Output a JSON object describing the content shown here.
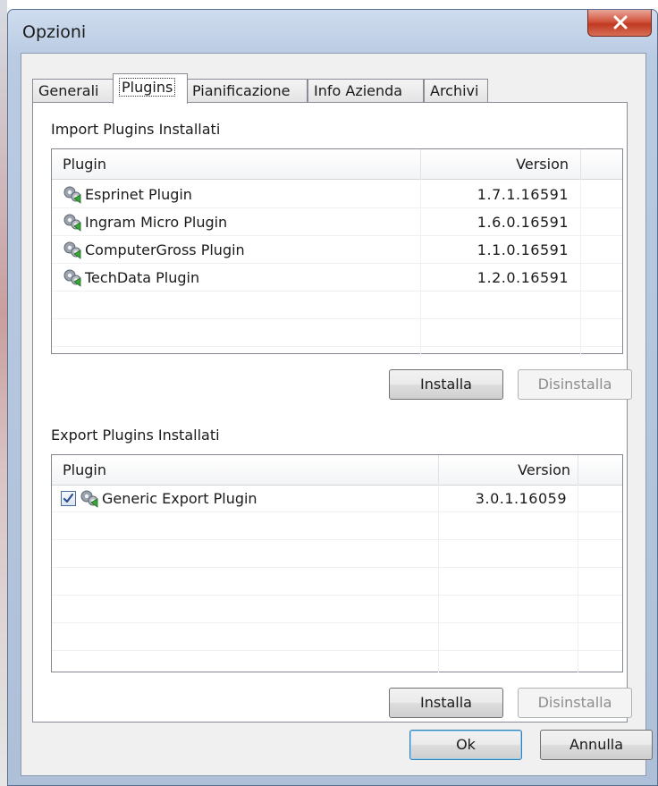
{
  "window": {
    "title": "Opzioni"
  },
  "tabs": [
    {
      "label": "Generali"
    },
    {
      "label": "Plugins"
    },
    {
      "label": "Pianificazione"
    },
    {
      "label": "Info Azienda"
    },
    {
      "label": "Archivi"
    }
  ],
  "active_tab": "Plugins",
  "import_section": {
    "label": "Import Plugins Installati",
    "columns": {
      "plugin": "Plugin",
      "version": "Version"
    },
    "rows": [
      {
        "name": "Esprinet Plugin",
        "version": "1.7.1.16591",
        "icon": "gears-icon"
      },
      {
        "name": "Ingram Micro Plugin",
        "version": "1.6.0.16591",
        "icon": "gears-icon"
      },
      {
        "name": "ComputerGross Plugin",
        "version": "1.1.0.16591",
        "icon": "gears-icon"
      },
      {
        "name": "TechData Plugin",
        "version": "1.2.0.16591",
        "icon": "gears-icon"
      }
    ],
    "install_label": "Installa",
    "uninstall_label": "Disinstalla"
  },
  "export_section": {
    "label": "Export Plugins Installati",
    "columns": {
      "plugin": "Plugin",
      "version": "Version"
    },
    "rows": [
      {
        "name": "Generic Export Plugin",
        "version": "3.0.1.16059",
        "checked": true,
        "icon": "gears-icon"
      }
    ],
    "install_label": "Installa",
    "uninstall_label": "Disinstalla"
  },
  "footer": {
    "ok_label": "Ok",
    "cancel_label": "Annulla"
  },
  "colors": {
    "title_bar": "#b9cbe3",
    "close_button": "#c8452c",
    "panel_border": "#898c95"
  }
}
